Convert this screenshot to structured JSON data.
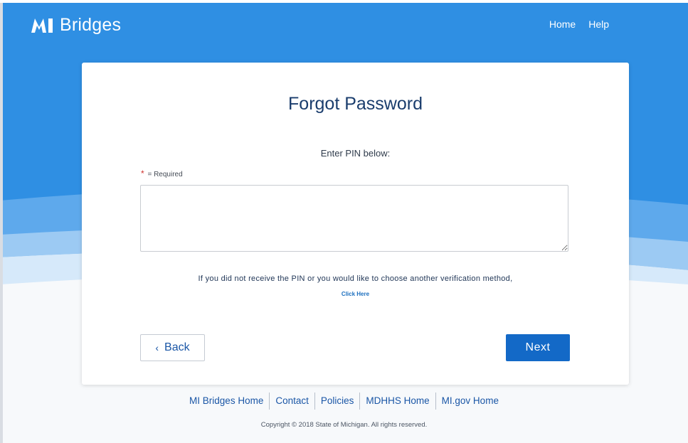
{
  "header": {
    "brand_mark": "MI",
    "brand_name": "Bridges",
    "nav": {
      "home": "Home",
      "help": "Help"
    }
  },
  "card": {
    "title": "Forgot Password",
    "instruction": "Enter PIN below:",
    "required_star": "*",
    "required_label": "= Required",
    "pin_input": {
      "value": "",
      "placeholder": ""
    },
    "hint": "If you did not receive the PIN or you would like to choose another verification method,",
    "click_here": "Click Here",
    "back_label": "Back",
    "next_label": "Next"
  },
  "footer": {
    "links": [
      "MI Bridges Home",
      "Contact",
      "Policies",
      "MDHHS Home",
      "MI.gov Home"
    ],
    "copyright": "Copyright © 2018 State of Michigan. All rights reserved."
  },
  "colors": {
    "header_blue": "#2f8fe3",
    "primary_button": "#1369c7",
    "title": "#1a3d6d",
    "link": "#1a56a6"
  }
}
